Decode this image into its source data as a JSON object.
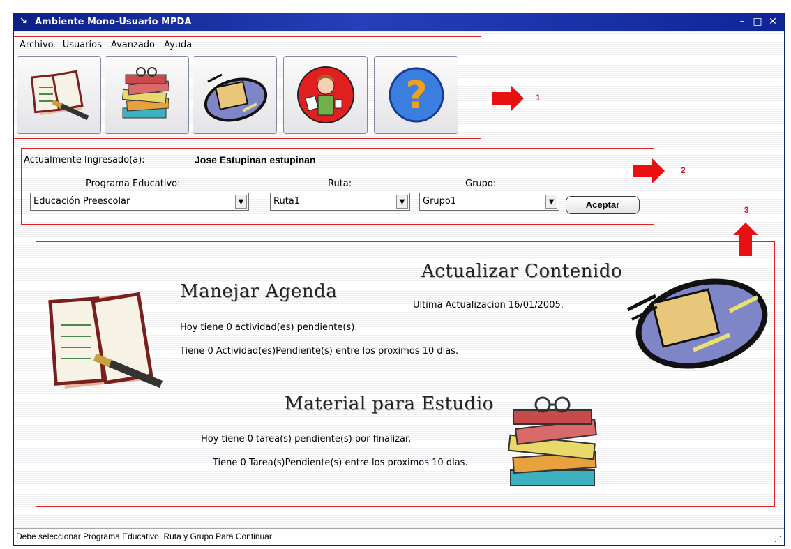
{
  "window": {
    "title": "Ambiente Mono-Usuario MPDA"
  },
  "menu": [
    "Archivo",
    "Usuarios",
    "Avanzado",
    "Ayuda"
  ],
  "toolbar": {
    "buttons": [
      {
        "icon": "agenda-icon"
      },
      {
        "icon": "books-icon"
      },
      {
        "icon": "folder-update-icon"
      },
      {
        "icon": "user-study-icon"
      },
      {
        "icon": "help-question-icon"
      }
    ]
  },
  "annotations": [
    "1",
    "2",
    "3"
  ],
  "login": {
    "label": "Actualmente Ingresado(a):",
    "user": "Jose Estupinan estupinan"
  },
  "filters": {
    "programa": {
      "label": "Programa Educativo:",
      "value": "Educación Preescolar"
    },
    "ruta": {
      "label": "Ruta:",
      "value": "Ruta1"
    },
    "grupo": {
      "label": "Grupo:",
      "value": "Grupo1"
    },
    "accept_label": "Aceptar"
  },
  "dashboard": {
    "agenda": {
      "title": "Manejar Agenda",
      "line1": "Hoy tiene 0 actividad(es) pendiente(s).",
      "line2": "Tiene 0 Actividad(es)Pendiente(s) entre los proximos 10 dias."
    },
    "update": {
      "title": "Actualizar Contenido",
      "last": "Ultima Actualizacion  16/01/2005."
    },
    "material": {
      "title": "Material para Estudio",
      "line1": "Hoy tiene 0 tarea(s) pendiente(s) por finalizar.",
      "line2": "Tiene 0 Tarea(s)Pendiente(s) entre los proximos 10 dias."
    }
  },
  "status": "Debe seleccionar Programa Educativo, Ruta y Grupo Para Continuar",
  "colors": {
    "title_bar": "#1a33a8",
    "annotation_red": "#e01010"
  }
}
